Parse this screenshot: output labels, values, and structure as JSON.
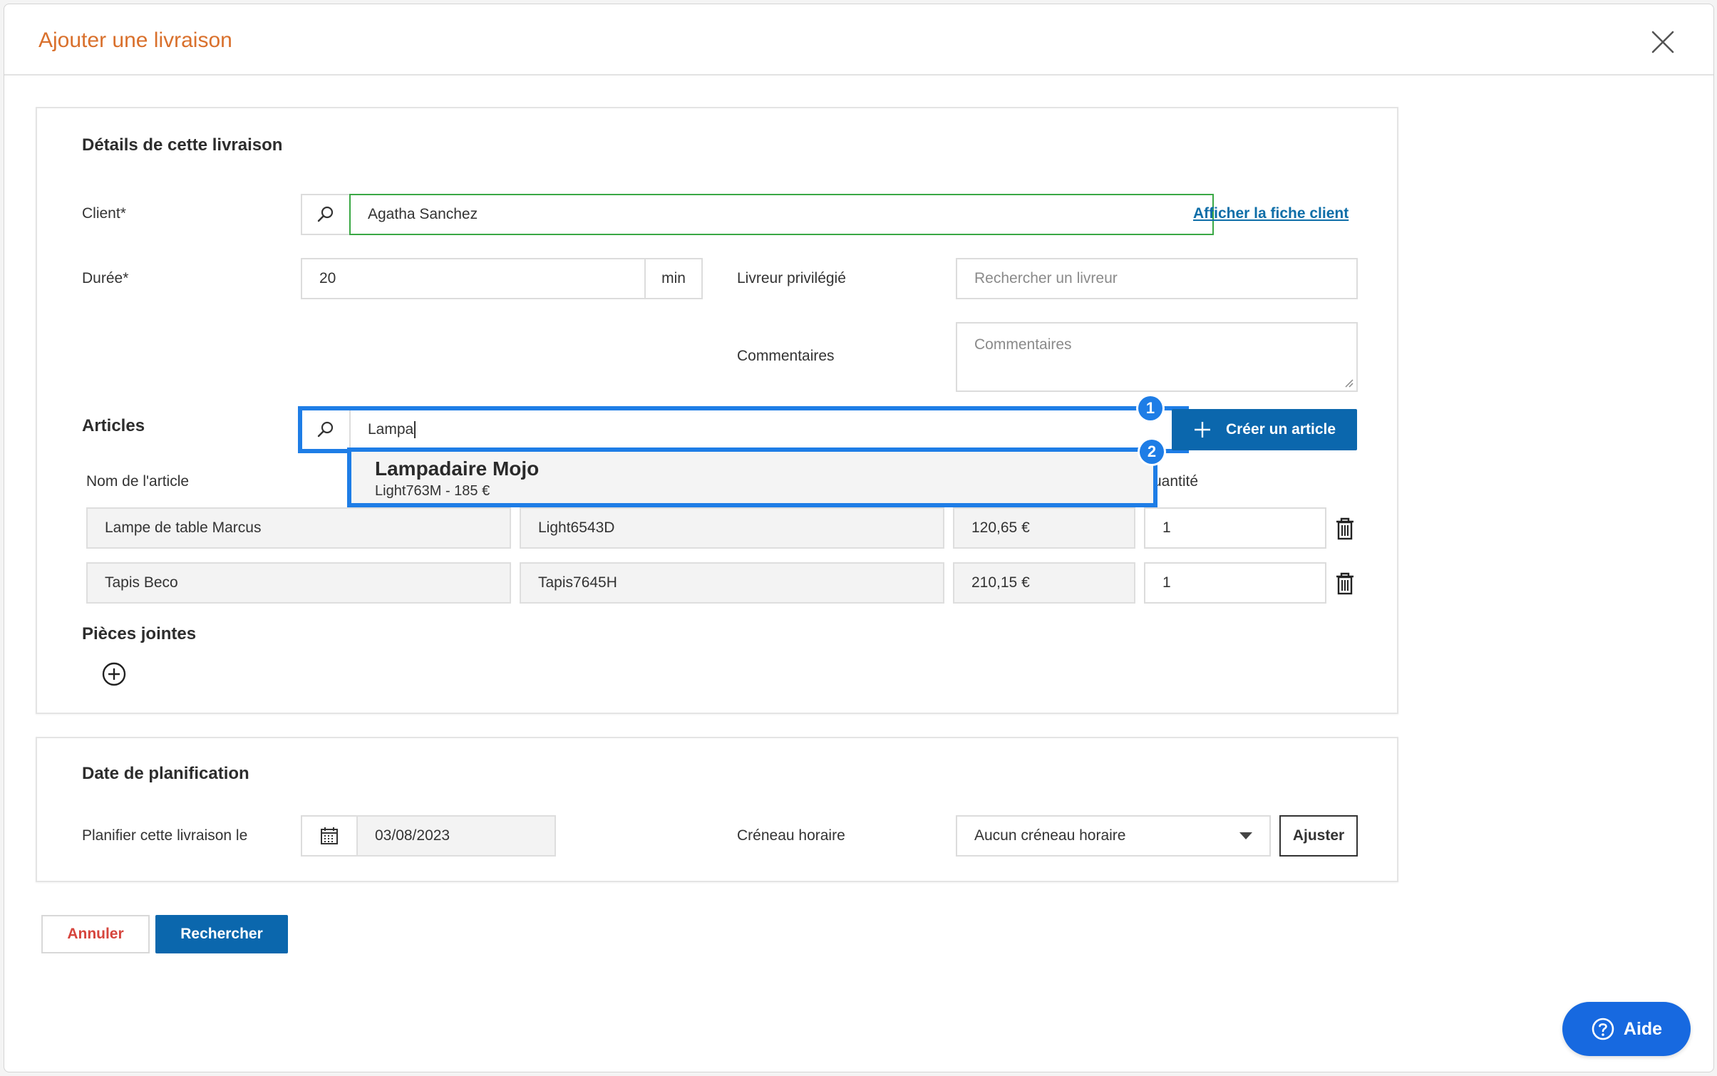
{
  "modal": {
    "title": "Ajouter une livraison",
    "close_icon": "close-icon"
  },
  "details": {
    "title": "Détails de cette livraison",
    "client_label": "Client*",
    "client_value": "Agatha Sanchez",
    "client_link": "Afficher la fiche client",
    "duree_label": "Durée*",
    "duree_value": "20",
    "duree_unit": "min",
    "livreur_label": "Livreur privilégié",
    "livreur_placeholder": "Rechercher un livreur",
    "commentaires_label": "Commentaires",
    "commentaires_placeholder": "Commentaires"
  },
  "articles": {
    "label": "Articles",
    "search_value": "Lampa",
    "create_button": "Créer un article",
    "column_name": "Nom de l'article",
    "column_quantity": "uantité",
    "badge_1": "1",
    "badge_2": "2",
    "suggestion": {
      "name": "Lampadaire Mojo",
      "detail": "Light763M - 185 €"
    },
    "rows": [
      {
        "name": "Lampe de table Marcus",
        "ref": "Light6543D",
        "price": "120,65 €",
        "quantity": "1"
      },
      {
        "name": "Tapis Beco",
        "ref": "Tapis7645H",
        "price": "210,15 €",
        "quantity": "1"
      }
    ]
  },
  "attachments": {
    "title": "Pièces jointes"
  },
  "planning": {
    "title": "Date de planification",
    "date_label": "Planifier cette livraison le",
    "date_value": "03/08/2023",
    "slot_label": "Créneau horaire",
    "slot_value": "Aucun créneau horaire",
    "adjust_button": "Ajuster"
  },
  "footer": {
    "cancel": "Annuler",
    "search": "Rechercher",
    "help": "Aide"
  },
  "colors": {
    "title_orange": "#d9702c",
    "primary_blue": "#0b67ad",
    "highlight_blue": "#1e7de6",
    "client_green_border": "#3aa845",
    "cancel_red": "#d6453d"
  }
}
